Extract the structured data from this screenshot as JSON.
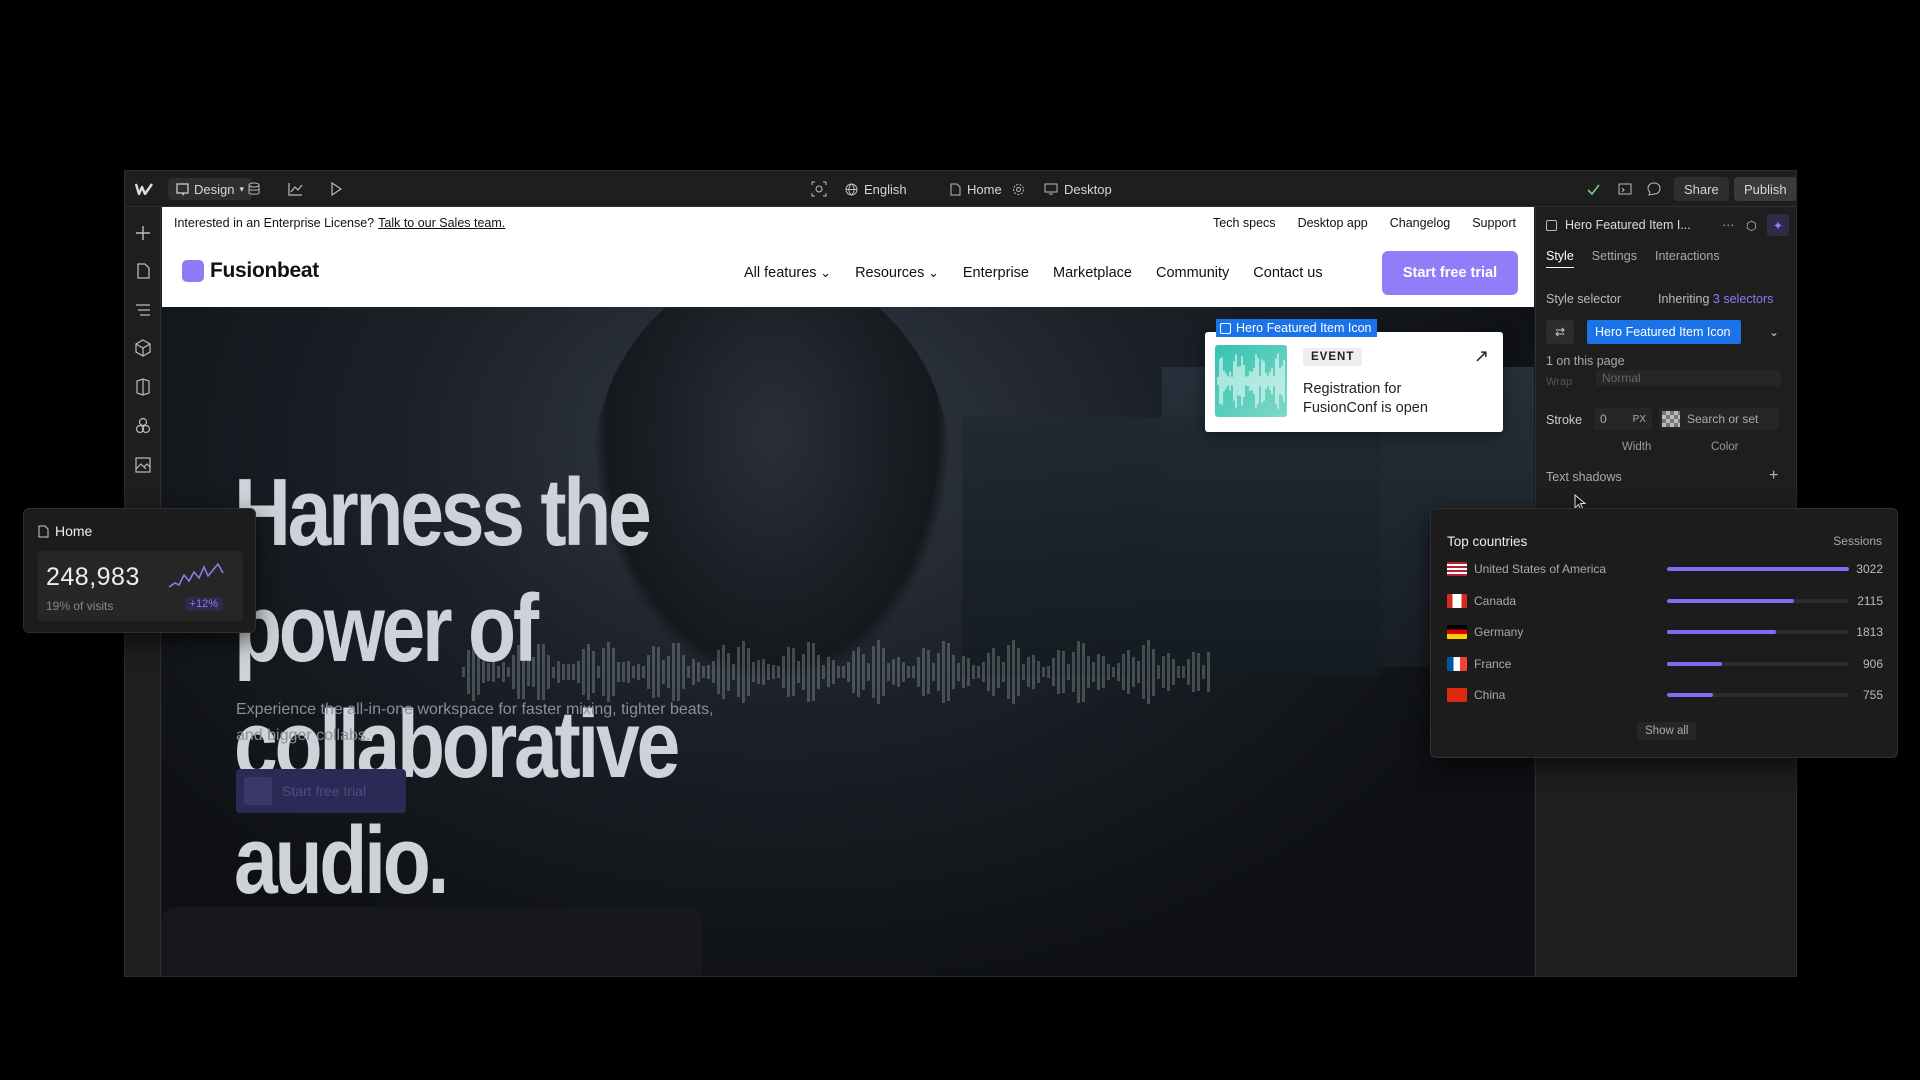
{
  "topbar": {
    "mode_label": "Design",
    "locale_label": "English",
    "page_label": "Home",
    "breakpoint_label": "Desktop",
    "share_label": "Share",
    "publish_label": "Publish"
  },
  "site": {
    "announcement": "Interested in an Enterprise License?",
    "announcement_link": "Talk to our Sales team.",
    "top_links": [
      "Tech specs",
      "Desktop app",
      "Changelog",
      "Support"
    ],
    "brand": "Fusionbeat",
    "nav": [
      "All features",
      "Resources",
      "Enterprise",
      "Marketplace",
      "Community",
      "Contact us"
    ],
    "cta": "Start free trial",
    "hero_title": "Harness the power of collaborative audio.",
    "hero_subtitle": "Experience the all-in-one workspace for faster mixing, tighter beats, and bigger collabs.",
    "hero_cta": "Start free trial",
    "featured": {
      "selected_label": "Hero Featured Item Icon",
      "tag": "EVENT",
      "text": "Registration for FusionConf is open"
    }
  },
  "panel": {
    "element_name": "Hero Featured Item I...",
    "tabs": [
      "Style",
      "Settings",
      "Interactions"
    ],
    "style_selector_label": "Style selector",
    "inheriting_label": "Inheriting",
    "inheriting_count": "3 selectors",
    "selector_value": "Hero Featured Item Icon",
    "on_page": "1 on this page",
    "wrap_label": "Wrap",
    "wrap_value": "Normal",
    "stroke_label": "Stroke",
    "stroke_width": "0",
    "stroke_unit": "PX",
    "stroke_color_placeholder": "Search or set",
    "width_label": "Width",
    "color_label": "Color",
    "text_shadows_label": "Text shadows"
  },
  "home_card": {
    "title": "Home",
    "visits": "248,983",
    "subtitle": "19% of visits",
    "badge": "+12%"
  },
  "countries": {
    "title": "Top countries",
    "sessions_label": "Sessions",
    "show_all": "Show all",
    "rows": [
      {
        "name": "United States of America",
        "value": "3022",
        "share": 1.0
      },
      {
        "name": "Canada",
        "value": "2115",
        "share": 0.7
      },
      {
        "name": "Germany",
        "value": "1813",
        "share": 0.6
      },
      {
        "name": "France",
        "value": "906",
        "share": 0.3
      },
      {
        "name": "China",
        "value": "755",
        "share": 0.25
      }
    ]
  },
  "colors": {
    "accent": "#8f7ef7",
    "selection": "#1a73e8"
  }
}
